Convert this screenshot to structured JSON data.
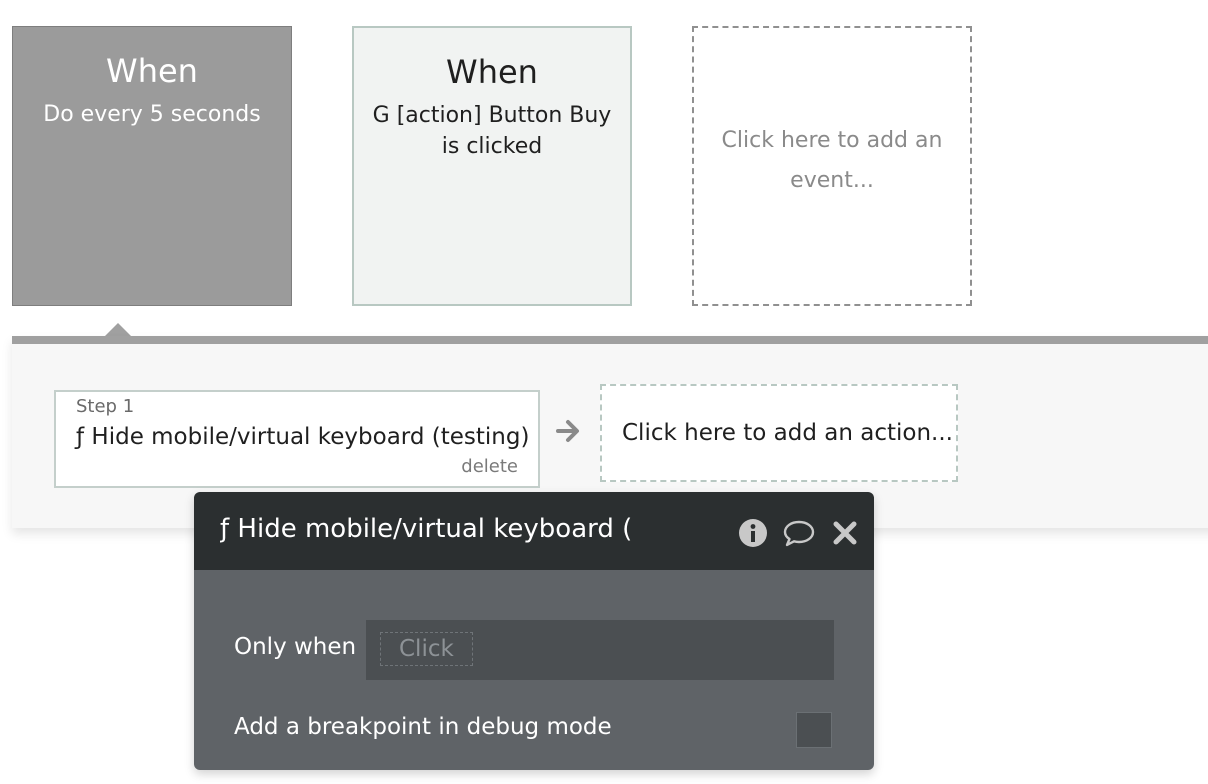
{
  "events": [
    {
      "heading": "When",
      "description": "Do every 5 seconds",
      "state": "selected"
    },
    {
      "heading": "When",
      "description": "G [action] Button Buy is clicked",
      "state": "normal"
    }
  ],
  "add_event": {
    "label": "Click here to add an event..."
  },
  "actions": {
    "step_label": "Step 1",
    "step_title": "ƒ Hide mobile/virtual keyboard (testing)",
    "delete_label": "delete",
    "add_action_label": "Click here to add an action..."
  },
  "property_editor": {
    "title": "ƒ Hide mobile/virtual keyboard (",
    "only_when_label": "Only when",
    "condition_placeholder": "Click",
    "breakpoint_label": "Add a breakpoint in debug mode",
    "breakpoint_checked": false
  },
  "colors": {
    "selected_event_bg": "#9b9b9b",
    "editor_header_bg": "#2b2f30",
    "editor_body_bg": "#5f6367"
  }
}
